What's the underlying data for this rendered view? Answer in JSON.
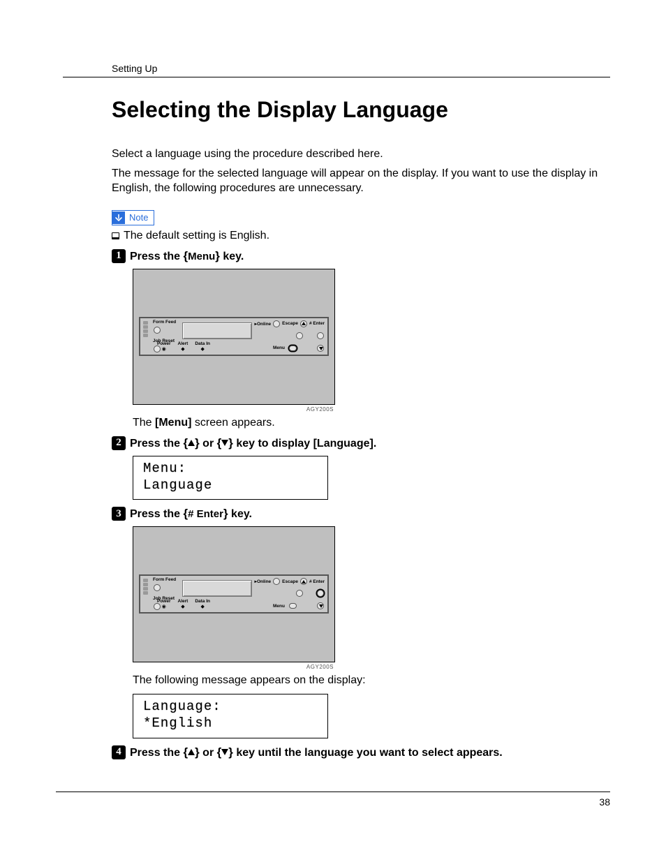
{
  "header": {
    "section": "Setting Up"
  },
  "title": "Selecting the Display Language",
  "intro": {
    "p1": "Select a language using the procedure described here.",
    "p2": "The message for the selected language will appear on the display. If you want to use the display in English, the following procedures are unnecessary."
  },
  "note": {
    "label": "Note",
    "text": "The default setting is English."
  },
  "steps": {
    "s1": {
      "num": "1",
      "pre": "Press the ",
      "key": "Menu",
      "post": " key.",
      "result": "The ",
      "result_key": "[Menu]",
      "result_post": " screen appears."
    },
    "s2": {
      "num": "2",
      "pre": "Press the ",
      "mid": " or ",
      "post1": " key to display ",
      "target": "[Language]",
      "post2": "."
    },
    "s3": {
      "num": "3",
      "pre": "Press the ",
      "key": "# Enter",
      "post": " key.",
      "result": "The following message appears on the display:"
    },
    "s4": {
      "num": "4",
      "pre": "Press the ",
      "mid": " or ",
      "post": " key until the language you want to select appears."
    }
  },
  "lcd1": {
    "line1": "Menu:",
    "line2": " Language"
  },
  "lcd2": {
    "line1": "Language:",
    "line2": "*English"
  },
  "panel": {
    "form_feed": "Form Feed",
    "job_reset": "Job Reset",
    "power": "Power",
    "alert": "Alert",
    "data_in": "Data In",
    "online": "Online",
    "escape": "Escape",
    "enter": "# Enter",
    "menu": "Menu",
    "caption": "AGY200S"
  },
  "page_number": "38"
}
